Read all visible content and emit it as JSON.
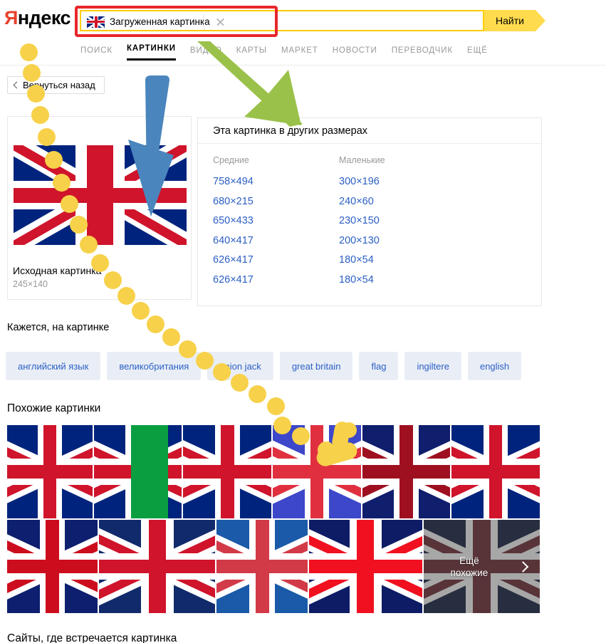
{
  "header": {
    "logo_ya": "Я",
    "logo_rest": "ндекс",
    "search_chip_label": "Загруженная картинка",
    "search_placeholder": "",
    "search_value": "",
    "find_button": "Найти",
    "clear_icon": "close-icon",
    "chip_icon": "uk-flag-icon"
  },
  "tabs": [
    {
      "label": "ПОИСК",
      "active": false
    },
    {
      "label": "КАРТИНКИ",
      "active": true
    },
    {
      "label": "ВИДЕО",
      "active": false
    },
    {
      "label": "КАРТЫ",
      "active": false
    },
    {
      "label": "МАРКЕТ",
      "active": false
    },
    {
      "label": "НОВОСТИ",
      "active": false
    },
    {
      "label": "ПЕРЕВОДЧИК",
      "active": false
    },
    {
      "label": "ЕЩЁ",
      "active": false
    }
  ],
  "back_button": {
    "label": "Вернуться назад",
    "icon": "chevron-left-icon"
  },
  "image_card": {
    "caption": "Исходная картинка",
    "dimensions": "245×140"
  },
  "sizes_panel": {
    "title": "Эта картинка в других размерах",
    "columns": [
      {
        "header": "Средние",
        "items": [
          "758×494",
          "680×215",
          "650×433",
          "640×417",
          "626×417",
          "626×417"
        ]
      },
      {
        "header": "Маленькие",
        "items": [
          "300×196",
          "240×60",
          "230×150",
          "200×130",
          "180×54",
          "180×54"
        ]
      }
    ]
  },
  "tags_section": {
    "title": "Кажется, на картинке",
    "tags": [
      "английский язык",
      "великобритания",
      "union jack",
      "great britain",
      "flag",
      "ingiltere",
      "english"
    ]
  },
  "similar_section": {
    "title": "Похожие картинки",
    "row1_widths": [
      124,
      128,
      128,
      128,
      128,
      128
    ],
    "row2_widths": [
      128,
      164,
      128,
      160,
      164
    ],
    "more_tile": {
      "line1": "Ещё",
      "line2": "похожие",
      "icon": "chevron-right-icon"
    }
  },
  "sites_section": {
    "title": "Сайты, где встречается картинка"
  },
  "colors": {
    "brand_yellow": "#ffdb4d",
    "logo_red": "#e8412c",
    "link_blue": "#2b5fc4",
    "tag_bg": "#e9eef6",
    "annotation_red": "#e8262a",
    "annotation_green": "#9ac24a",
    "annotation_blue": "#4a86bd",
    "cursor_yellow": "#f7d14a"
  }
}
